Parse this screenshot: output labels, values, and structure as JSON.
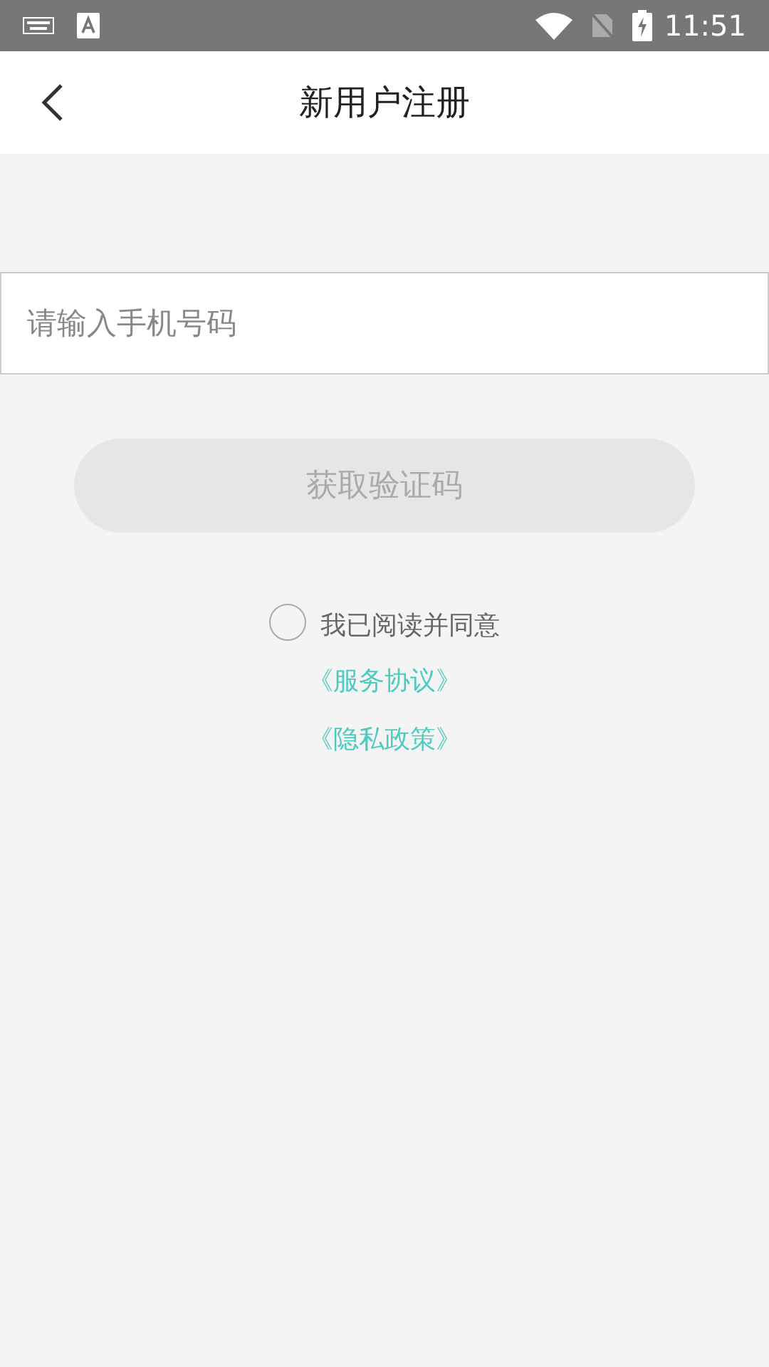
{
  "status_bar": {
    "time": "11:51"
  },
  "header": {
    "title": "新用户注册"
  },
  "phone_field": {
    "placeholder": "请输入手机号码"
  },
  "code_button": {
    "label": "获取验证码",
    "disabled": true
  },
  "agreement": {
    "text": "我已阅读并同意",
    "checked": false,
    "links": [
      "《服务协议》",
      "《隐私政策》"
    ]
  }
}
